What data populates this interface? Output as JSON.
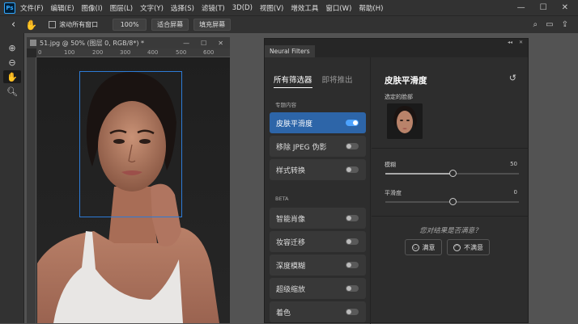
{
  "menubar": {
    "logo": "Ps",
    "items": [
      "文件(F)",
      "编辑(E)",
      "图像(I)",
      "图层(L)",
      "文字(Y)",
      "选择(S)",
      "滤镜(T)",
      "3D(D)",
      "视图(V)",
      "增效工具",
      "窗口(W)",
      "帮助(H)"
    ],
    "window_controls": [
      "—",
      "☐",
      "✕"
    ]
  },
  "options_bar": {
    "back_icon": "chevron-left-icon",
    "hand_icon": "hand-icon",
    "scroll_all_label": "滚动所有窗口",
    "zoom_value": "100%",
    "fit_screen_label": "适合屏幕",
    "fill_screen_label": "填充屏幕"
  },
  "tools": [
    "zoom-in-icon",
    "zoom-out-icon",
    "hand-icon",
    "zoom-icon"
  ],
  "document": {
    "title": "51.jpg @ 50% (图层 0, RGB/8*) *",
    "ruler_ticks": [
      "0",
      "100",
      "200",
      "300",
      "400",
      "500",
      "600"
    ]
  },
  "neural_filters": {
    "panel_title": "Neural Filters",
    "tabs": [
      "所有筛选器",
      "即将推出"
    ],
    "featured_section": "专题内容",
    "featured_filters": [
      {
        "label": "皮肤平滑度",
        "enabled": true,
        "selected": true
      },
      {
        "label": "移除 JPEG 伪影",
        "enabled": false,
        "selected": false
      },
      {
        "label": "样式转换",
        "enabled": false,
        "selected": false
      }
    ],
    "beta_section": "BETA",
    "beta_filters": [
      {
        "label": "智能肖像",
        "enabled": false
      },
      {
        "label": "妆容迁移",
        "enabled": false
      },
      {
        "label": "深度模糊",
        "enabled": false
      },
      {
        "label": "超级缩放",
        "enabled": false
      },
      {
        "label": "着色",
        "enabled": false
      }
    ],
    "detail": {
      "title": "皮肤平滑度",
      "selected_face_label": "选定的脸部",
      "blur_label": "模糊",
      "blur_value": "50",
      "blur_level": 0.5,
      "smoothness_label": "平滑度",
      "smoothness_value": "0",
      "smoothness_level": 0.5,
      "feedback_question": "您对结果是否满意？",
      "satisfied_label": "满意",
      "unsatisfied_label": "不满意"
    }
  }
}
